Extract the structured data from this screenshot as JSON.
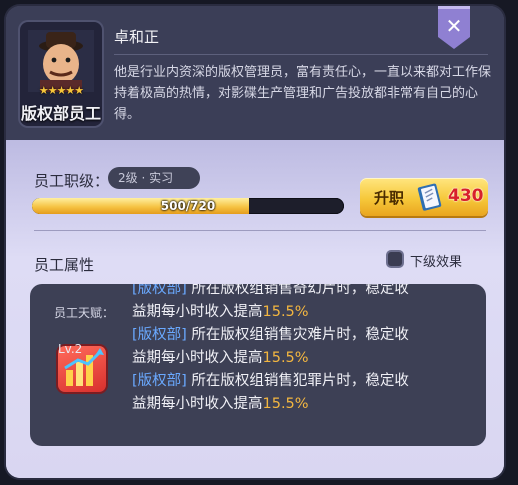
{
  "employee": {
    "portrait_label": "版权部员工",
    "stars": "★★★★★",
    "name": "卓和正",
    "description": "他是行业内资深的版权管理员，富有责任心，一直以来都对工作保持着极高的热情，对影碟生产管理和广告投放都非常有自己的心得。"
  },
  "close_icon": "close-icon",
  "level": {
    "label": "员工职级：",
    "value": "2级 · 实习",
    "xp_text": "500/720",
    "xp_current": 500,
    "xp_max": 720
  },
  "promote": {
    "label": "升职",
    "cost": "430",
    "cost_icon": "book-icon"
  },
  "attributes": {
    "title": "员工属性",
    "sub_effect_label": "下级效果",
    "talent_label": "员工天赋：",
    "talent_level": "Lv.2",
    "talents": [
      {
        "line1_tag": "[版权部]",
        "line1_text": " 所在版权组销售奇幻片时，稳定收",
        "line2_text": "益期每小时收入提高",
        "pct": "15.5%"
      },
      {
        "line1_tag": "[版权部]",
        "line1_text": " 所在版权组销售灾难片时，稳定收",
        "line2_text": "益期每小时收入提高",
        "pct": "15.5%"
      },
      {
        "line1_tag": "[版权部]",
        "line1_text": " 所在版权组销售犯罪片时，稳定收",
        "line2_text": "益期每小时收入提高",
        "pct": "15.5%"
      }
    ]
  },
  "colors": {
    "header_bg": "#3b3e57",
    "accent_gold": "#f6c83a",
    "cost_red": "#d8202a",
    "tag_blue": "#6aa9ff",
    "pct_orange": "#f3b640"
  }
}
